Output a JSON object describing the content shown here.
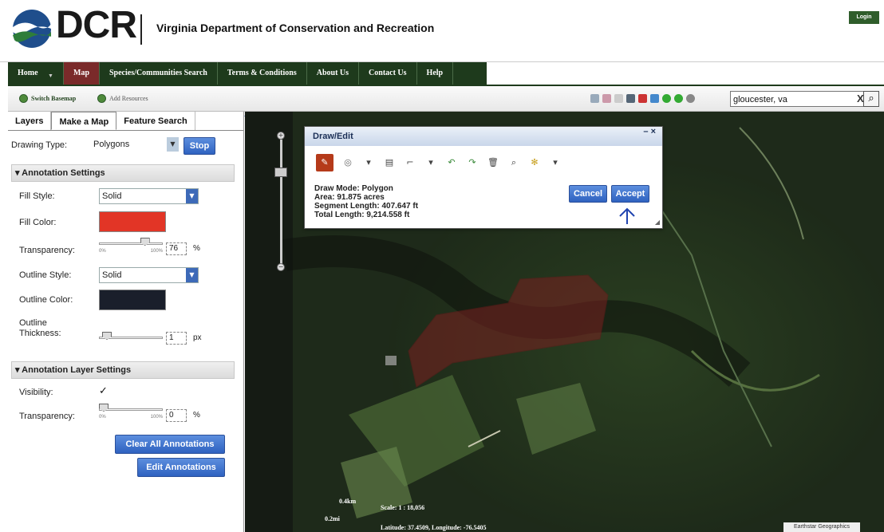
{
  "header": {
    "logo_text": "DCR",
    "agency": "Virginia Department of Conservation and Recreation",
    "login": "Login"
  },
  "nav": {
    "items": [
      {
        "label": "Home"
      },
      {
        "label": "Map"
      },
      {
        "label": "Species/Communities Search"
      },
      {
        "label": "Terms & Conditions"
      },
      {
        "label": "About Us"
      },
      {
        "label": "Contact Us"
      },
      {
        "label": "Help"
      }
    ]
  },
  "toolbar": {
    "switch_basemap": "Switch Basemap",
    "add_resources": "Add Resources",
    "search_value": "gloucester, va",
    "search_clear": "X"
  },
  "panel": {
    "tabs": [
      "Layers",
      "Make a Map",
      "Feature Search"
    ],
    "drawing_type_label": "Drawing Type:",
    "drawing_type_value": "Polygons",
    "stop": "Stop",
    "annotation_settings": "Annotation Settings",
    "fill_style_label": "Fill Style:",
    "fill_style_value": "Solid",
    "fill_color_label": "Fill Color:",
    "fill_color": "#e23526",
    "transparency_label": "Transparency:",
    "transparency_value": "76",
    "transparency_unit": "%",
    "slider_min": "0%",
    "slider_max": "100%",
    "fill_transparency_level": 0.76,
    "outline_style_label": "Outline Style:",
    "outline_style_value": "Solid",
    "outline_color_label": "Outline Color:",
    "outline_color": "#1a1f2b",
    "outline_thickness_label1": "Outline",
    "outline_thickness_label2": "Thickness:",
    "outline_thickness_value": "1",
    "outline_thickness_unit": "px",
    "layer_settings": "Annotation Layer Settings",
    "visibility_label": "Visibility:",
    "visibility_check": "✓",
    "layer_transparency_label": "Transparency:",
    "layer_transparency_value": "0",
    "layer_transparency_unit": "%",
    "clear_all": "Clear All Annotations",
    "edit_annotations": "Edit Annotations"
  },
  "dialog": {
    "title": "Draw/Edit",
    "controls": "– ×",
    "mode": "Draw Mode: Polygon",
    "area": "Area: 91.875 acres",
    "segment": "Segment Length: 407.647 ft",
    "total": "Total Length: 9,214.558 ft",
    "cancel": "Cancel",
    "accept": "Accept"
  },
  "map": {
    "scale_km": "0.4km",
    "scale_mi": "0.2mi",
    "scale": "Scale: 1 : 18,056",
    "coords": "Latitude: 37.4509, Longitude: -76.5405",
    "attribution": "Earthstar Geographics"
  }
}
